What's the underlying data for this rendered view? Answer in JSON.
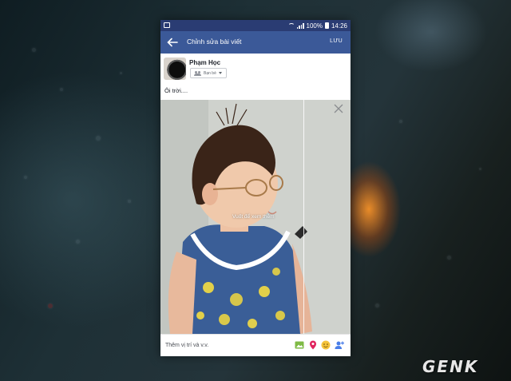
{
  "status_bar": {
    "battery": "100%",
    "time": "14:26",
    "icons": [
      "gallery-icon",
      "wifi-icon",
      "signal-icon",
      "battery-icon"
    ]
  },
  "app_bar": {
    "title": "Chỉnh sửa bài viết",
    "save_label": "LƯU",
    "back_icon": "back-arrow-icon",
    "color": "#3b5998"
  },
  "post": {
    "author": "Phạm Học",
    "audience": "Bạn bè",
    "audience_icon": "friends-icon",
    "text": "Ôi trời....",
    "photo_hint": "Vuốt để xem thêm"
  },
  "bottom_bar": {
    "add_details": "Thêm vị trí và v.v.",
    "icons": [
      "photo-icon",
      "location-pin-icon",
      "emoji-icon",
      "tag-people-icon"
    ]
  },
  "watermark": "GENK"
}
